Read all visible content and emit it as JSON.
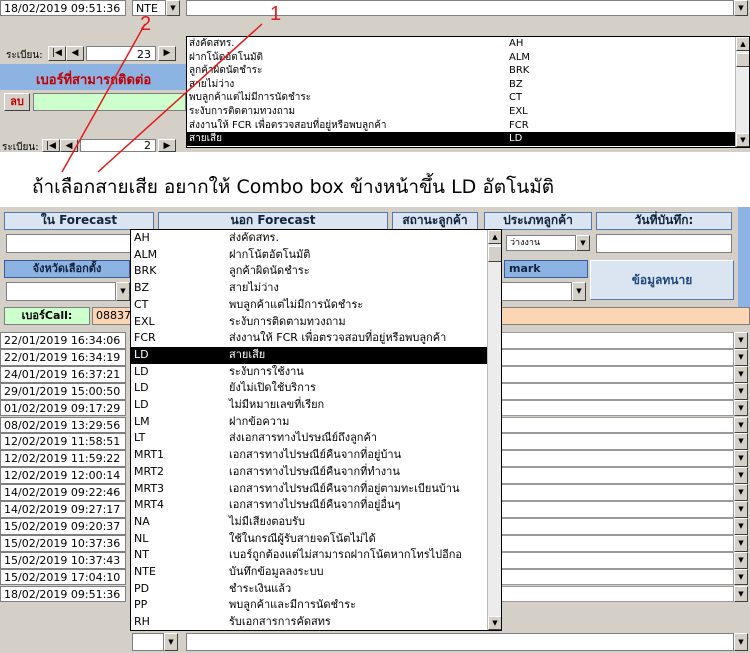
{
  "top_panel": {
    "datetime": "18/02/2019 09:51:36",
    "code_value": "NTE",
    "record_nav_label": "ระเบียน:",
    "record_nav_value": "23",
    "record_nav_label_2": "ระเบียน:",
    "record_nav_value_2": "2",
    "reachable_number_label": "เบอร์ที่สามารถติดต่อ",
    "delete_button": "ลบ",
    "list_items": [
      {
        "desc": "ส่งคัดสทร.",
        "code": "AH"
      },
      {
        "desc": "ฝากโน้ตอัตโนมัติ",
        "code": "ALM"
      },
      {
        "desc": "ลูกค้าผิดนัดชำระ",
        "code": "BRK"
      },
      {
        "desc": "สายไม่ว่าง",
        "code": "BZ"
      },
      {
        "desc": "พบลูกค้าแต่ไม่มีการนัดชำระ",
        "code": "CT"
      },
      {
        "desc": "ระงับการติดตามทวงถาม",
        "code": "EXL"
      },
      {
        "desc": "ส่งงานให้ FCR เพื่อตรวจสอบที่อยู่หรือพบลูกค้า",
        "code": "FCR"
      },
      {
        "desc": "สายเสีย",
        "code": "LD"
      }
    ],
    "selected_index": 7
  },
  "annotations": {
    "marker_1": "1",
    "marker_2": "2",
    "caption": "ถ้าเลือกสายเสีย อยากให้ Combo box ข้างหน้าขึ้น LD อัตโนมัติ"
  },
  "bottom_panel": {
    "headers": {
      "in_forecast": "ใน Forecast",
      "out_forecast": "นอก Forecast",
      "customer_status": "สถานะลูกค้า",
      "customer_type": "ประเภทลูกค้า",
      "record_date": "วันที่บันทึก:"
    },
    "customer_type_value": "ว่างงาน",
    "province_label": "จังหวัดเลือกตั้ง",
    "remark_label": "mark",
    "lawyer_info_button": "ข้อมูลทนาย",
    "phone_call_label": "เบอร์Call:",
    "phone_call_value": "08837",
    "timestamps": [
      "22/01/2019 16:34:06",
      "22/01/2019 16:34:19",
      "24/01/2019 16:37:21",
      "29/01/2019 15:00:50",
      "01/02/2019 09:17:29",
      "08/02/2019 13:29:56",
      "12/02/2019 11:58:51",
      "12/02/2019 11:59:22",
      "12/02/2019 12:00:14",
      "14/02/2019 09:22:46",
      "14/02/2019 09:27:17",
      "15/02/2019 09:20:37",
      "15/02/2019 10:37:36",
      "15/02/2019 10:37:43",
      "15/02/2019 17:04:10",
      "18/02/2019 09:51:36"
    ],
    "list_items": [
      {
        "code": "AH",
        "desc": "ส่งคัดสทร."
      },
      {
        "code": "ALM",
        "desc": "ฝากโน้ตอัตโนมัติ"
      },
      {
        "code": "BRK",
        "desc": "ลูกค้าผิดนัดชำระ"
      },
      {
        "code": "BZ",
        "desc": "สายไม่ว่าง"
      },
      {
        "code": "CT",
        "desc": "พบลูกค้าแต่ไม่มีการนัดชำระ"
      },
      {
        "code": "EXL",
        "desc": "ระงับการติดตามทวงถาม"
      },
      {
        "code": "FCR",
        "desc": "ส่งงานให้ FCR เพื่อตรวจสอบที่อยู่หรือพบลูกค้า"
      },
      {
        "code": "LD",
        "desc": "สายเสีย"
      },
      {
        "code": "LD",
        "desc": "ระงับการใช้งาน"
      },
      {
        "code": "LD",
        "desc": "ยังไม่เปิดใช้บริการ"
      },
      {
        "code": "LD",
        "desc": "ไม่มีหมายเลขที่เรียก"
      },
      {
        "code": "LM",
        "desc": "ฝากข้อความ"
      },
      {
        "code": "LT",
        "desc": "ส่งเอกสารทางไปรษณีย์ถึงลูกค้า"
      },
      {
        "code": "MRT1",
        "desc": "เอกสารทางไปรษณีย์คืนจากที่อยู่บ้าน"
      },
      {
        "code": "MRT2",
        "desc": "เอกสารทางไปรษณีย์คืนจากที่ทำงาน"
      },
      {
        "code": "MRT3",
        "desc": "เอกสารทางไปรษณีย์คืนจากที่อยู่ตามทะเบียนบ้าน"
      },
      {
        "code": "MRT4",
        "desc": "เอกสารทางไปรษณีย์คืนจากที่อยู่อื่นๆ"
      },
      {
        "code": "NA",
        "desc": "ไม่มีเสียงตอบรับ"
      },
      {
        "code": "NL",
        "desc": "ใช้ในกรณีผู้รับสายจดโน้ตไม่ได้"
      },
      {
        "code": "NT",
        "desc": "เบอร์ถูกต้องแต่ไม่สามารถฝากโน้ตหากโทรไปอีกอ"
      },
      {
        "code": "NTE",
        "desc": "บันทึกข้อมูลลงระบบ"
      },
      {
        "code": "PD",
        "desc": "ชำระเงินแล้ว"
      },
      {
        "code": "PP",
        "desc": "พบลูกค้าและมีการนัดชำระ"
      },
      {
        "code": "RH",
        "desc": "รับเอกสารการคัดสทร"
      }
    ],
    "selected_index": 7
  },
  "colors": {
    "header_light": "#dbe5f1",
    "header_mid": "#8db3e2",
    "dark_red_text": "#c00000",
    "green_input": "#ccffcc",
    "orange_input": "#fcd5b4",
    "selection": "#000000",
    "annotation_red": "#e31b1b"
  }
}
